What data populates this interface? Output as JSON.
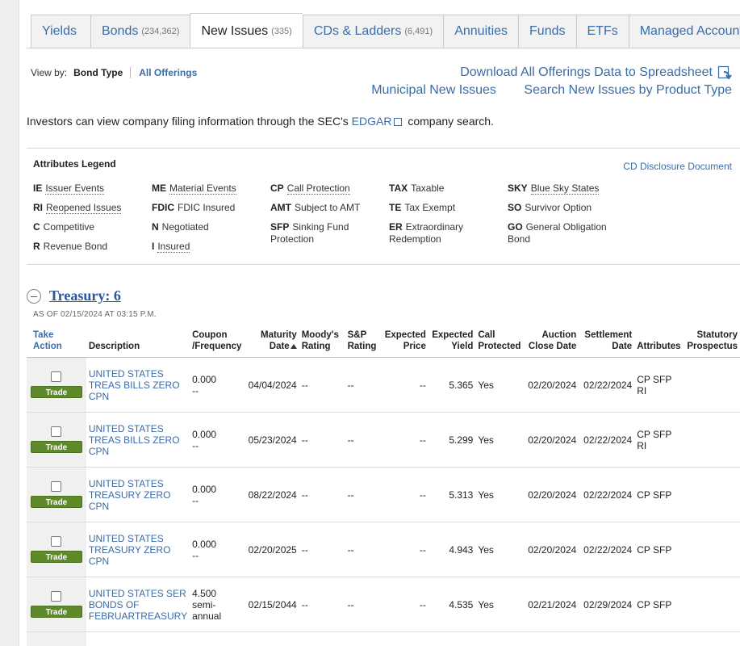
{
  "tabs": [
    {
      "label": "Yields",
      "count": ""
    },
    {
      "label": "Bonds",
      "count": "(234,362)"
    },
    {
      "label": "New Issues",
      "count": "(335)"
    },
    {
      "label": "CDs & Ladders",
      "count": "(6,491)"
    },
    {
      "label": "Annuities",
      "count": ""
    },
    {
      "label": "Funds",
      "count": ""
    },
    {
      "label": "ETFs",
      "count": ""
    },
    {
      "label": "Managed Accounts",
      "count": ""
    }
  ],
  "viewby": {
    "label": "View by:",
    "selected": "Bond Type",
    "other": "All Offerings"
  },
  "links": {
    "download": "Download All Offerings Data to Spreadsheet",
    "municipal": "Municipal New Issues",
    "search": "Search New Issues by Product Type"
  },
  "sec": {
    "before": "Investors can view company filing information through the SEC's",
    "link": "EDGAR",
    "after": "company search."
  },
  "legend": {
    "title": "Attributes Legend",
    "cd_link": "CD Disclosure Document",
    "items": [
      {
        "code": "IE",
        "desc": "Issuer Events"
      },
      {
        "code": "RI",
        "desc": "Reopened Issues"
      },
      {
        "code": "C",
        "desc": "Competitive"
      },
      {
        "code": "R",
        "desc": "Revenue Bond"
      },
      {
        "code": "ME",
        "desc": "Material Events"
      },
      {
        "code": "FDIC",
        "desc": "FDIC Insured"
      },
      {
        "code": "N",
        "desc": "Negotiated"
      },
      {
        "code": "I",
        "desc": "Insured"
      },
      {
        "code": "CP",
        "desc": "Call Protection"
      },
      {
        "code": "AMT",
        "desc": "Subject to AMT"
      },
      {
        "code": "SFP",
        "desc": "Sinking Fund Protection"
      },
      {
        "code": "TAX",
        "desc": "Taxable"
      },
      {
        "code": "TE",
        "desc": "Tax Exempt"
      },
      {
        "code": "ER",
        "desc": "Extraordinary Redemption"
      },
      {
        "code": "SKY",
        "desc": "Blue Sky States"
      },
      {
        "code": "SO",
        "desc": "Survivor Option"
      },
      {
        "code": "GO",
        "desc": "General Obligation Bond"
      }
    ]
  },
  "treasury": {
    "title": "Treasury: 6",
    "asof": "AS OF 02/15/2024 AT 03:15 P.M."
  },
  "table": {
    "headers": {
      "take1": "Take",
      "take2": "Action",
      "description": "Description",
      "coupon1": "Coupon",
      "coupon2": "/Frequency",
      "maturity1": "Maturity",
      "maturity2": "Date",
      "moodys1": "Moody's",
      "moodys2": "Rating",
      "sp1": "S&P",
      "sp2": "Rating",
      "price1": "Expected",
      "price2": "Price",
      "yield1": "Expected",
      "yield2": "Yield",
      "call1": "Call",
      "call2": "Protected",
      "auction1": "Auction",
      "auction2": "Close Date",
      "settle1": "Settlement",
      "settle2": "Date",
      "attributes": "Attributes",
      "statutory1": "Statutory",
      "statutory2": "Prospectus"
    },
    "trade_label": "Trade",
    "rows": [
      {
        "desc": "UNITED STATES TREAS BILLS ZERO CPN",
        "coupon": "0.000",
        "freq": "--",
        "maturity": "04/04/2024",
        "moodys": "--",
        "sp": "--",
        "price": "--",
        "yield": "5.365",
        "call": "Yes",
        "auction": "02/20/2024",
        "settle": "02/22/2024",
        "attrs": "CP SFP RI"
      },
      {
        "desc": "UNITED STATES TREAS BILLS ZERO CPN",
        "coupon": "0.000",
        "freq": "--",
        "maturity": "05/23/2024",
        "moodys": "--",
        "sp": "--",
        "price": "--",
        "yield": "5.299",
        "call": "Yes",
        "auction": "02/20/2024",
        "settle": "02/22/2024",
        "attrs": "CP SFP RI"
      },
      {
        "desc": "UNITED STATES TREASURY ZERO CPN",
        "coupon": "0.000",
        "freq": "--",
        "maturity": "08/22/2024",
        "moodys": "--",
        "sp": "--",
        "price": "--",
        "yield": "5.313",
        "call": "Yes",
        "auction": "02/20/2024",
        "settle": "02/22/2024",
        "attrs": "CP SFP"
      },
      {
        "desc": "UNITED STATES TREASURY ZERO CPN",
        "coupon": "0.000",
        "freq": "--",
        "maturity": "02/20/2025",
        "moodys": "--",
        "sp": "--",
        "price": "--",
        "yield": "4.943",
        "call": "Yes",
        "auction": "02/20/2024",
        "settle": "02/22/2024",
        "attrs": "CP SFP"
      },
      {
        "desc": "UNITED STATES SER BONDS OF FEBRUARTREASURY",
        "coupon": "4.500",
        "freq": "semi-annual",
        "maturity": "02/15/2044",
        "moodys": "--",
        "sp": "--",
        "price": "--",
        "yield": "4.535",
        "call": "Yes",
        "auction": "02/21/2024",
        "settle": "02/29/2024",
        "attrs": "CP SFP"
      }
    ]
  }
}
